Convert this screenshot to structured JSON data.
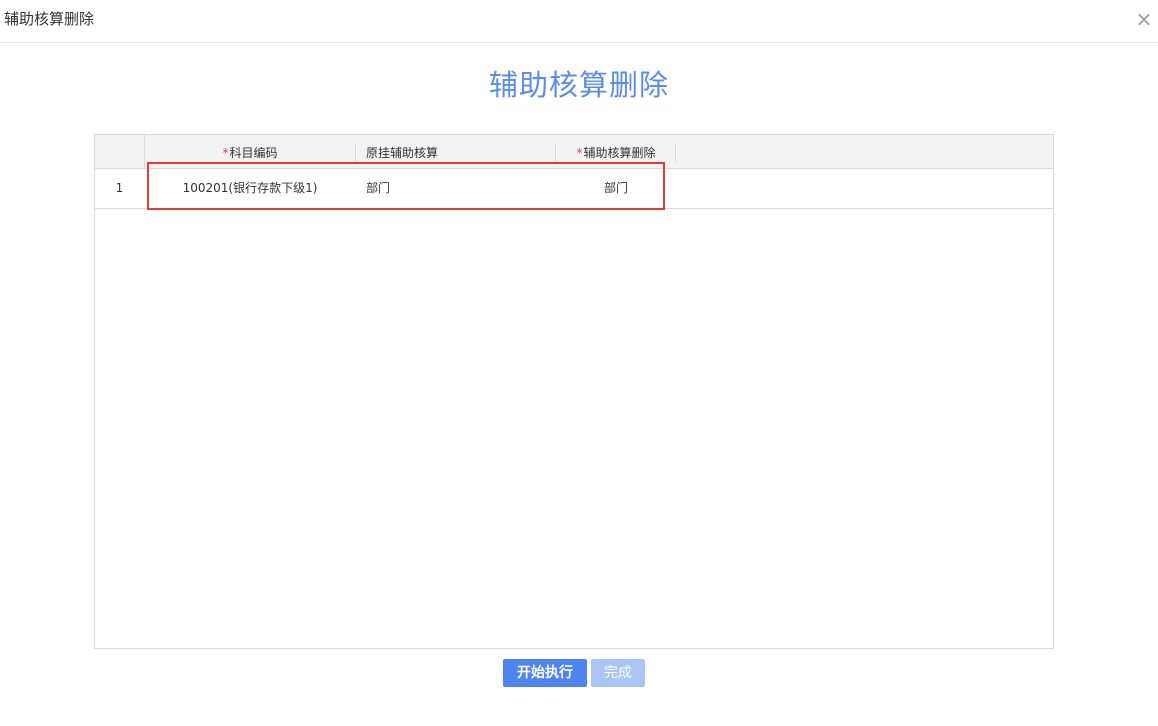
{
  "dialog": {
    "title": "辅助核算删除",
    "close_glyph": "×"
  },
  "heading": "辅助核算删除",
  "table": {
    "columns": [
      {
        "label": "科目编码",
        "required": true
      },
      {
        "label": "原挂辅助核算",
        "required": false
      },
      {
        "label": "辅助核算删除",
        "required": true
      }
    ],
    "required_mark": "*",
    "rows": [
      {
        "index": "1",
        "account_code": "100201(银行存款下级1)",
        "original_aux": "部门",
        "delete_aux": "部门"
      }
    ]
  },
  "buttons": {
    "start": "开始执行",
    "done": "完成"
  },
  "colors": {
    "accent": "#4d84ee",
    "heading": "#5b8de6",
    "highlight": "#e23b3b",
    "required": "#e04646",
    "disabled": "#a9c4f5"
  }
}
